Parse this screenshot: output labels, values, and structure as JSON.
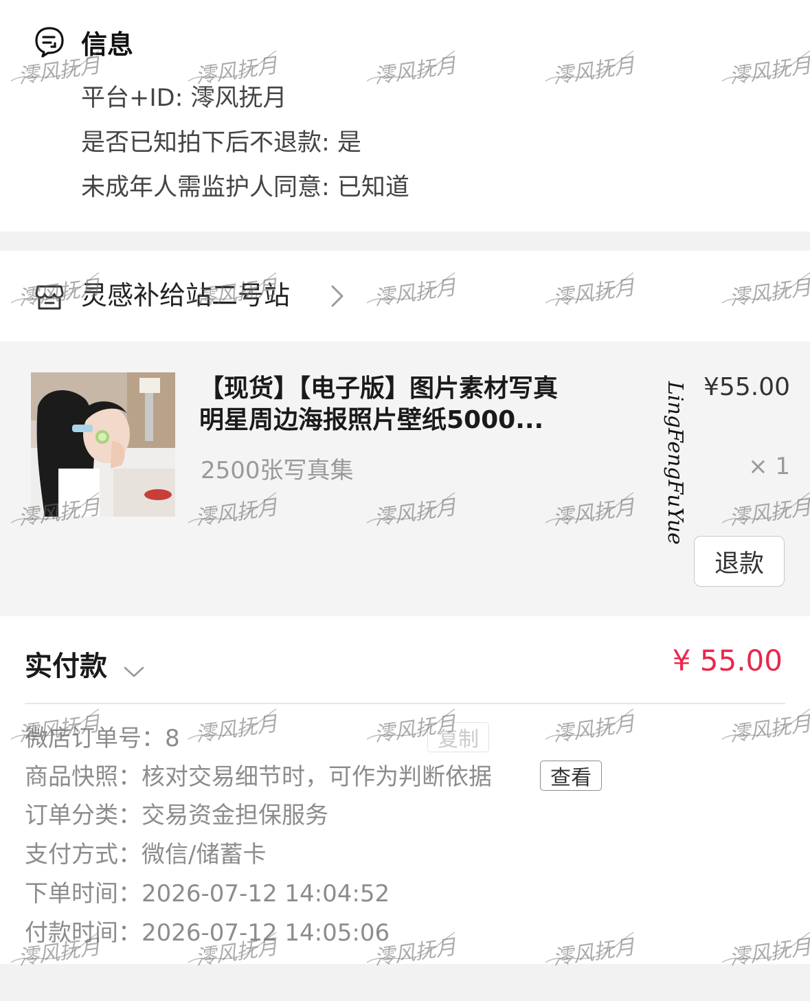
{
  "info": {
    "title": "信息",
    "lines": [
      "平台+ID: 澪风抚月",
      "是否已知拍下后不退款: 是",
      "未成年人需监护人同意: 已知道"
    ]
  },
  "shop": {
    "name": "灵感补给站二号站"
  },
  "product": {
    "title_line1": "【现货】【电子版】图片素材写真",
    "title_line2": "明星周边海报照片壁纸5000...",
    "sku": "2500张写真集",
    "price": "¥55.00",
    "quantity": "× 1",
    "refund_label": "退款",
    "signature": "LingFengFuYue"
  },
  "payment": {
    "label": "实付款",
    "amount": "¥ 55.00",
    "details": [
      {
        "key": "微店订单号：",
        "value": "8"
      },
      {
        "key": "商品快照：",
        "value": "核对交易细节时，可作为判断依据"
      },
      {
        "key": "订单分类：",
        "value": "交易资金担保服务"
      },
      {
        "key": "支付方式：",
        "value": "微信/储蓄卡"
      },
      {
        "key": "下单时间：",
        "value": "2026-07-12 14:04:52"
      },
      {
        "key": "付款时间：",
        "value": "2026-07-12 14:05:06"
      }
    ],
    "copy_label": "复制",
    "view_label": "查看"
  },
  "watermark_text": "澪风抚月",
  "colors": {
    "price_red": "#e8284b",
    "background": "#f2f2f2",
    "card_grey": "#f4f4f4"
  },
  "icons": {
    "info": "chat-document-icon",
    "shop": "shop-icon",
    "shop_arrow": "chevron-right-icon",
    "pay_arrow": "chevron-down-icon"
  }
}
